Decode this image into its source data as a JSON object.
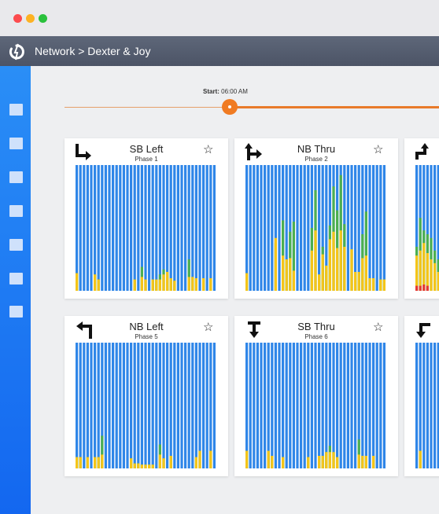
{
  "header": {
    "breadcrumb": "Network > Dexter & Joy"
  },
  "timeline": {
    "start_label": "Start:",
    "start_time": "06:00 AM"
  },
  "colors": {
    "blue": "#2f86e8",
    "green": "#4caf50",
    "yellow": "#f5c518",
    "red": "#e53935",
    "accent": "#f07b22"
  },
  "cards": [
    {
      "title": "SB Left",
      "phase": "Phase 1",
      "icon": "sb-left-arrow-icon",
      "green_levels": [
        0.14,
        0,
        0,
        0,
        0,
        0.13,
        0.09,
        0,
        0,
        0,
        0,
        0,
        0,
        0,
        0,
        0,
        0.09,
        0,
        0.19,
        0.09,
        0,
        0.09,
        0.09,
        0.13,
        0.17,
        0.15,
        0.1,
        0.08,
        0,
        0,
        0,
        0.25,
        0.11,
        0.1,
        0,
        0.1,
        0,
        0.1,
        0
      ],
      "yellow_levels": [
        0.14,
        0,
        0,
        0,
        0,
        0.13,
        0.09,
        0,
        0,
        0,
        0,
        0,
        0,
        0,
        0,
        0,
        0.09,
        0,
        0.11,
        0.09,
        0,
        0.09,
        0.09,
        0.09,
        0.13,
        0.15,
        0.1,
        0.08,
        0,
        0,
        0,
        0.11,
        0.11,
        0.1,
        0,
        0.1,
        0,
        0.1,
        0
      ],
      "red_levels": [
        0,
        0,
        0,
        0,
        0,
        0,
        0,
        0,
        0,
        0,
        0,
        0,
        0,
        0,
        0,
        0,
        0,
        0,
        0,
        0,
        0,
        0,
        0,
        0,
        0,
        0,
        0,
        0,
        0,
        0,
        0,
        0,
        0,
        0,
        0,
        0,
        0,
        0,
        0
      ]
    },
    {
      "title": "NB Thru",
      "phase": "Phase 2",
      "icon": "nb-thru-right-arrow-icon",
      "green_levels": [
        0.14,
        0,
        0,
        0,
        0,
        0,
        0,
        0,
        0.38,
        0,
        0.56,
        0.25,
        0.47,
        0.55,
        0,
        0,
        0,
        0,
        0.5,
        0.8,
        0.13,
        0.35,
        0.2,
        0.52,
        0.83,
        0.64,
        0.92,
        0.53,
        0,
        0.33,
        0.15,
        0.15,
        0.45,
        0.63,
        0.1,
        0.1,
        0,
        0.09,
        0.09
      ],
      "yellow_levels": [
        0.14,
        0,
        0,
        0,
        0,
        0,
        0,
        0,
        0.42,
        0,
        0.28,
        0.25,
        0.26,
        0.16,
        0,
        0,
        0,
        0,
        0.32,
        0.48,
        0.13,
        0.29,
        0.2,
        0.41,
        0.47,
        0.34,
        0.48,
        0.35,
        0,
        0.33,
        0.15,
        0.15,
        0.26,
        0.28,
        0.1,
        0.1,
        0,
        0.09,
        0.09
      ],
      "red_levels": [
        0,
        0,
        0,
        0,
        0,
        0,
        0,
        0,
        0,
        0,
        0,
        0,
        0,
        0,
        0,
        0,
        0,
        0,
        0,
        0,
        0,
        0,
        0,
        0,
        0,
        0,
        0,
        0,
        0,
        0,
        0,
        0,
        0,
        0,
        0,
        0,
        0,
        0,
        0
      ]
    },
    {
      "title": "",
      "phase": "",
      "icon": "partial-arrow-icon",
      "green_levels": [
        0.35,
        0.58,
        0.48,
        0.45,
        0.42,
        0.32,
        0.25
      ],
      "yellow_levels": [
        0.28,
        0.32,
        0.38,
        0.3,
        0.25,
        0.22,
        0.15
      ],
      "red_levels": [
        0.04,
        0.04,
        0.05,
        0.04,
        0,
        0,
        0
      ]
    },
    {
      "title": "NB Left",
      "phase": "Phase 5",
      "icon": "nb-left-arrow-icon",
      "green_levels": [
        0.09,
        0.09,
        0,
        0.09,
        0,
        0.09,
        0.09,
        0.26,
        0,
        0,
        0,
        0,
        0,
        0,
        0,
        0.08,
        0.04,
        0.04,
        0.03,
        0.03,
        0.03,
        0.03,
        0,
        0.19,
        0.08,
        0,
        0.1,
        0,
        0,
        0,
        0,
        0,
        0,
        0.09,
        0.14,
        0,
        0,
        0.14,
        0
      ],
      "yellow_levels": [
        0.09,
        0.09,
        0,
        0.09,
        0,
        0.09,
        0.09,
        0.11,
        0,
        0,
        0,
        0,
        0,
        0,
        0,
        0.08,
        0.04,
        0.04,
        0.03,
        0.03,
        0.03,
        0.03,
        0,
        0.11,
        0.08,
        0,
        0.1,
        0,
        0,
        0,
        0,
        0,
        0,
        0.09,
        0.14,
        0,
        0,
        0.14,
        0
      ],
      "red_levels": [
        0,
        0,
        0,
        0,
        0,
        0,
        0,
        0,
        0,
        0,
        0,
        0,
        0,
        0,
        0,
        0,
        0,
        0,
        0,
        0,
        0,
        0,
        0,
        0,
        0,
        0,
        0,
        0,
        0,
        0,
        0,
        0,
        0,
        0,
        0,
        0,
        0,
        0,
        0
      ]
    },
    {
      "title": "SB Thru",
      "phase": "Phase 6",
      "icon": "sb-thru-arrow-icon",
      "green_levels": [
        0.14,
        0,
        0,
        0,
        0,
        0,
        0.14,
        0.1,
        0,
        0,
        0.09,
        0,
        0,
        0,
        0,
        0,
        0,
        0.09,
        0,
        0,
        0.1,
        0.1,
        0.13,
        0.18,
        0.13,
        0.09,
        0,
        0,
        0,
        0,
        0,
        0.23,
        0.1,
        0.1,
        0,
        0.1,
        0,
        0,
        0
      ],
      "yellow_levels": [
        0.14,
        0,
        0,
        0,
        0,
        0,
        0.14,
        0.1,
        0,
        0,
        0.09,
        0,
        0,
        0,
        0,
        0,
        0,
        0.09,
        0,
        0,
        0.1,
        0.1,
        0.13,
        0.13,
        0.13,
        0.09,
        0,
        0,
        0,
        0,
        0,
        0.11,
        0.1,
        0.1,
        0,
        0.1,
        0,
        0,
        0
      ],
      "red_levels": [
        0,
        0,
        0,
        0,
        0,
        0,
        0,
        0,
        0,
        0,
        0,
        0,
        0,
        0,
        0,
        0,
        0,
        0,
        0,
        0,
        0,
        0,
        0,
        0,
        0,
        0,
        0,
        0,
        0,
        0,
        0,
        0,
        0,
        0,
        0,
        0,
        0,
        0,
        0
      ]
    },
    {
      "title": "",
      "phase": "",
      "icon": "partial-arrow-icon",
      "green_levels": [
        0,
        0.14,
        0,
        0,
        0,
        0,
        0
      ],
      "yellow_levels": [
        0,
        0.14,
        0,
        0,
        0,
        0,
        0
      ],
      "red_levels": [
        0,
        0,
        0,
        0,
        0,
        0,
        0
      ]
    }
  ]
}
